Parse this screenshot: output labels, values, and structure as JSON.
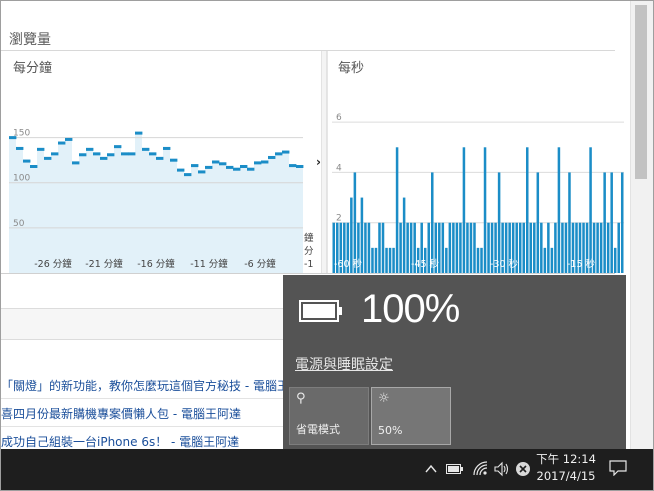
{
  "section": {
    "title": "瀏覽量"
  },
  "panels": {
    "per_minute_label": "每分鐘",
    "per_second_label": "每秒",
    "nav_arrow": "›"
  },
  "chart_data": [
    {
      "type": "bar",
      "title": "每分鐘",
      "y_ticks": [
        "150",
        "100",
        "50"
      ],
      "x_tick_labels": [
        "-26 分鐘",
        "-21 分鐘",
        "-16 分鐘",
        "-11 分鐘",
        "-6 分鐘"
      ],
      "partial_labels": [
        "鐘",
        "分",
        "-1"
      ],
      "ylim": [
        0,
        195
      ],
      "values": [
        150,
        138,
        124,
        118,
        137,
        127,
        132,
        144,
        148,
        122,
        131,
        137,
        132,
        127,
        131,
        140,
        132,
        132,
        155,
        137,
        132,
        127,
        138,
        125,
        114,
        109,
        119,
        112,
        117,
        123,
        121,
        117,
        115,
        118,
        115,
        122,
        123,
        128,
        132,
        134,
        119,
        118
      ]
    },
    {
      "type": "bar",
      "title": "每秒",
      "y_ticks": [
        "6",
        "4",
        "2"
      ],
      "x_tick_labels": [
        "-60 秒",
        "-45 秒",
        "-30 秒",
        "-15 秒"
      ],
      "ylim": [
        0,
        7
      ],
      "values": [
        2,
        2,
        2,
        2,
        2,
        3,
        4,
        2,
        3,
        2,
        2,
        1,
        1,
        2,
        2,
        1,
        1,
        1,
        5,
        2,
        3,
        2,
        2,
        2,
        1,
        2,
        1,
        2,
        4,
        2,
        2,
        2,
        1,
        2,
        2,
        2,
        2,
        5,
        2,
        2,
        2,
        1,
        1,
        5,
        2,
        2,
        2,
        4,
        2,
        2,
        2,
        2,
        2,
        2,
        2,
        5,
        2,
        2,
        4,
        2,
        1,
        2,
        1,
        2,
        5,
        2,
        2,
        4,
        2,
        2,
        2,
        2,
        2,
        5,
        2,
        2,
        2,
        4,
        2,
        4,
        1,
        2,
        4
      ]
    }
  ],
  "links": [
    "「關燈」的新功能，教你怎麼玩這個官方秘技 - 電腦王阿達",
    "喜四月份最新購機專案價懶人包 - 電腦王阿達",
    "成功自己組裝一台iPhone 6s！ - 電腦王阿達"
  ],
  "battery_flyout": {
    "percent": "100%",
    "charge_level": 1.0,
    "power_settings_link": "電源與睡眠設定",
    "tiles": [
      {
        "icon": "battery-saver-icon",
        "glyph": "⚲",
        "label": "省電模式"
      },
      {
        "icon": "brightness-icon",
        "glyph": "☼",
        "label": "50%"
      }
    ]
  },
  "taskbar": {
    "tray_icons": [
      "chevron-up-icon",
      "battery-icon",
      "wifi-icon",
      "volume-icon",
      "close-circle-icon"
    ],
    "clock_time": "下午 12:14",
    "clock_date": "2017/4/15",
    "notification_icon": "action-center-icon"
  },
  "colors": {
    "bar_blue": "#1b8dc7",
    "area_fill": "#e2f1f9",
    "flyout_bg": "#545454",
    "taskbar_bg": "#1e1e1e",
    "link_blue": "#1a4e9a"
  }
}
